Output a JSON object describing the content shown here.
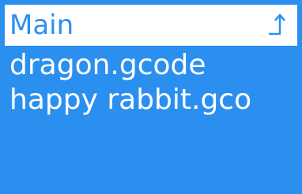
{
  "header": {
    "title": "Main",
    "back_icon": "up-arrow-icon"
  },
  "files": [
    {
      "name": "dragon.gcode"
    },
    {
      "name": "happy rabbit.gco"
    }
  ],
  "colors": {
    "accent": "#2b8ff0",
    "header_bg": "#ffffff",
    "text_on_accent": "#ffffff"
  }
}
